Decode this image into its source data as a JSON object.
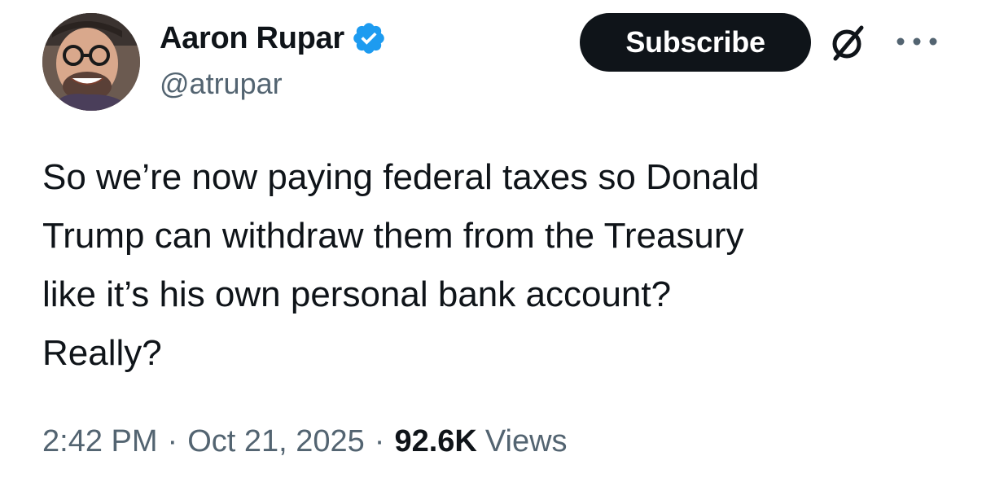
{
  "author": {
    "display_name": "Aaron Rupar",
    "handle": "@atrupar",
    "verified": true
  },
  "actions": {
    "subscribe_label": "Subscribe"
  },
  "tweet": {
    "lines": [
      "So we’re now paying federal taxes so Donald",
      "Trump can withdraw them from the Treasury",
      "like it’s his own personal bank account?",
      "Really?"
    ]
  },
  "meta": {
    "time": "2:42 PM",
    "date": "Oct 21, 2025",
    "views_count": "92.6K",
    "views_label": "Views",
    "separator": "·"
  },
  "icons": {
    "verified": "verified-badge-icon",
    "grok": "grok-icon",
    "more": "more-options-icon"
  },
  "colors": {
    "text_primary": "#0f1419",
    "text_secondary": "#536471",
    "verified_blue": "#1d9bf0",
    "button_bg": "#0f1419"
  }
}
